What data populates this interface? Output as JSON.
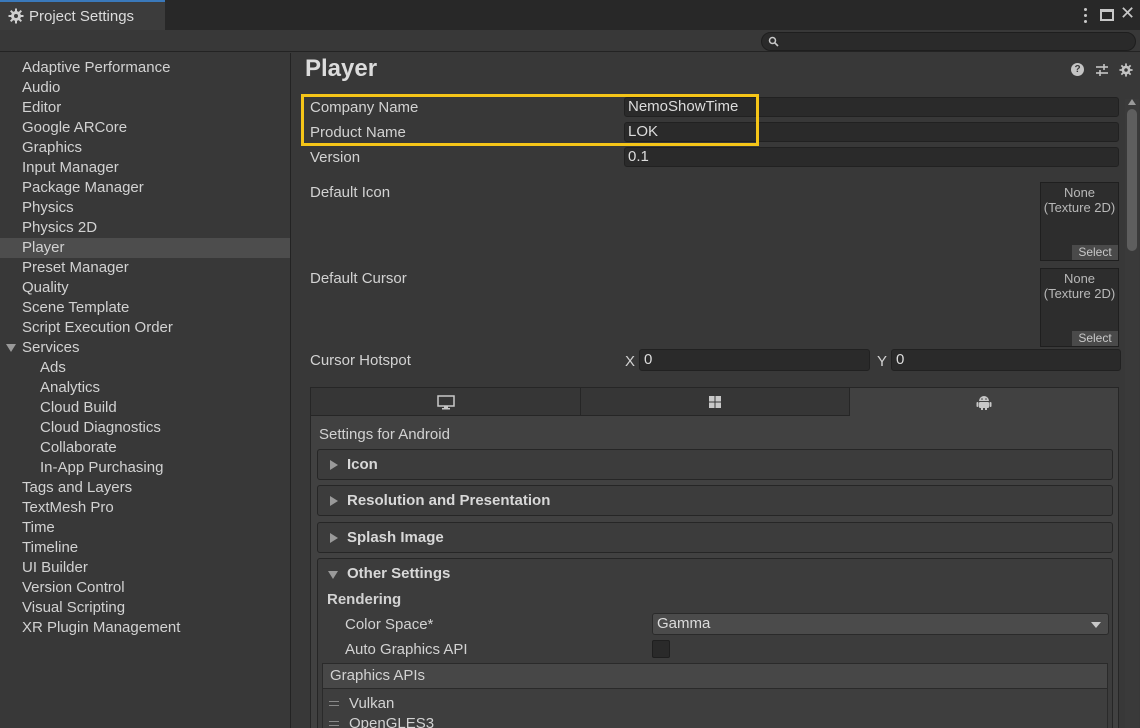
{
  "window": {
    "tab_title": "Project Settings",
    "search_placeholder": ""
  },
  "sidebar": {
    "items": [
      {
        "label": "Adaptive Performance"
      },
      {
        "label": "Audio"
      },
      {
        "label": "Editor"
      },
      {
        "label": "Google ARCore"
      },
      {
        "label": "Graphics"
      },
      {
        "label": "Input Manager"
      },
      {
        "label": "Package Manager"
      },
      {
        "label": "Physics"
      },
      {
        "label": "Physics 2D"
      },
      {
        "label": "Player",
        "selected": true
      },
      {
        "label": "Preset Manager"
      },
      {
        "label": "Quality"
      },
      {
        "label": "Scene Template"
      },
      {
        "label": "Script Execution Order"
      },
      {
        "label": "Services",
        "expanded": true
      },
      {
        "label": "Ads"
      },
      {
        "label": "Analytics"
      },
      {
        "label": "Cloud Build"
      },
      {
        "label": "Cloud Diagnostics"
      },
      {
        "label": "Collaborate"
      },
      {
        "label": "In-App Purchasing"
      },
      {
        "label": "Tags and Layers"
      },
      {
        "label": "TextMesh Pro"
      },
      {
        "label": "Time"
      },
      {
        "label": "Timeline"
      },
      {
        "label": "UI Builder"
      },
      {
        "label": "Version Control"
      },
      {
        "label": "Visual Scripting"
      },
      {
        "label": "XR Plugin Management"
      }
    ]
  },
  "player": {
    "title": "Player",
    "company_name_label": "Company Name",
    "company_name_value": "NemoShowTime",
    "product_name_label": "Product Name",
    "product_name_value": "LOK",
    "version_label": "Version",
    "version_value": "0.1",
    "default_icon_label": "Default Icon",
    "default_cursor_label": "Default Cursor",
    "texture_none_line1": "None",
    "texture_none_line2": "(Texture 2D)",
    "select_label": "Select",
    "cursor_hotspot_label": "Cursor Hotspot",
    "hotspot_x_label": "X",
    "hotspot_x_value": "0",
    "hotspot_y_label": "Y",
    "hotspot_y_value": "0",
    "highlight_color": "#f5c518"
  },
  "platform": {
    "tabs": [
      {
        "icon": "monitor-icon"
      },
      {
        "icon": "windows-icon"
      },
      {
        "icon": "android-icon",
        "active": true
      }
    ],
    "settings_for": "Settings for Android",
    "sections": {
      "icon": "Icon",
      "resolution": "Resolution and Presentation",
      "splash": "Splash Image",
      "other": "Other Settings"
    },
    "rendering_label": "Rendering",
    "color_space_label": "Color Space*",
    "color_space_value": "Gamma",
    "auto_graphics_label": "Auto Graphics API",
    "auto_graphics_checked": false,
    "graphics_apis_header": "Graphics APIs",
    "graphics_apis": [
      "Vulkan",
      "OpenGLES3"
    ]
  }
}
